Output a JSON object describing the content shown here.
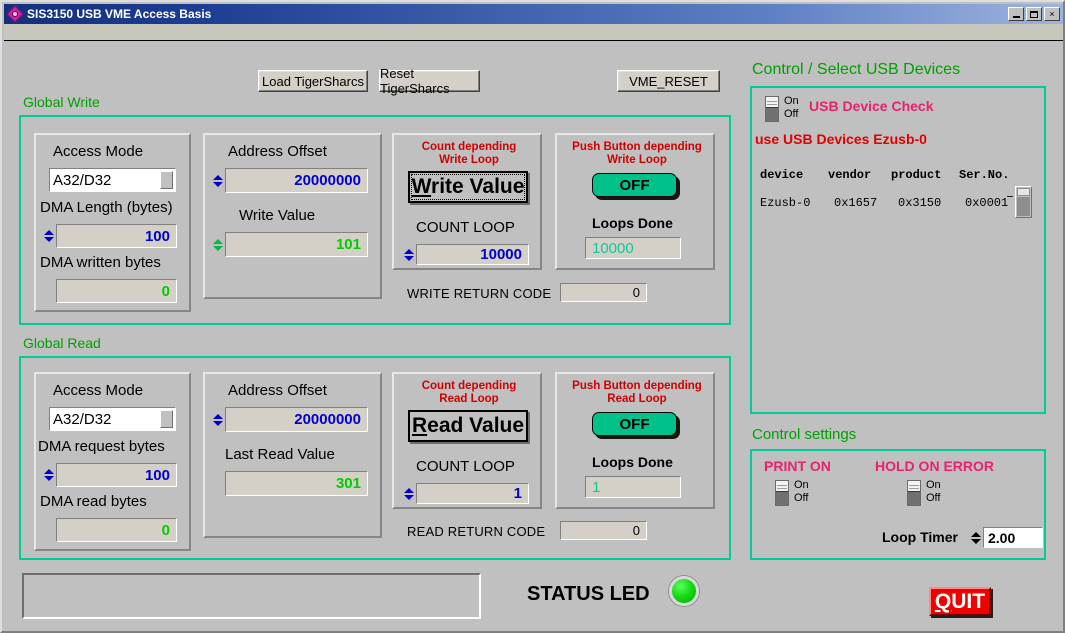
{
  "window": {
    "title": "SIS3150 USB VME Access Basis",
    "icon": "app-diamond-icon",
    "buttons": {
      "minimize": "_",
      "maximize": "□",
      "close": "×"
    }
  },
  "toolbar": {
    "load_tigersharcs": "Load TigerSharcs",
    "reset_tigersharcs": "Reset TigerSharcs",
    "vme_reset": "VME_RESET"
  },
  "global_write": {
    "title": "Global  Write",
    "access": {
      "access_mode_label": "Access Mode",
      "access_mode_value": "A32/D32",
      "dma_length_label": "DMA Length (bytes)",
      "dma_length_value": "100",
      "dma_written_label": "DMA written bytes",
      "dma_written_value": "0"
    },
    "address": {
      "address_offset_label": "Address Offset",
      "address_offset_value": "20000000",
      "write_value_label": "Write Value",
      "write_value_value": "101"
    },
    "count": {
      "caption_line1": "Count depending",
      "caption_line2": "Write Loop",
      "button_accel": "W",
      "button_rest": "rite Value",
      "count_loop_label": "COUNT LOOP",
      "count_loop_value": "10000"
    },
    "push": {
      "caption_line1": "Push Button depending",
      "caption_line2": "Write Loop",
      "toggle_state": "OFF",
      "loops_done_label": "Loops Done",
      "loops_done_value": "10000"
    },
    "return_code_label": "WRITE RETURN CODE",
    "return_code_value": "0"
  },
  "global_read": {
    "title": "Global  Read",
    "access": {
      "access_mode_label": "Access Mode",
      "access_mode_value": "A32/D32",
      "dma_request_label": "DMA request bytes",
      "dma_request_value": "100",
      "dma_read_label": "DMA read bytes",
      "dma_read_value": "0"
    },
    "address": {
      "address_offset_label": "Address Offset",
      "address_offset_value": "20000000",
      "last_read_label": "Last Read Value",
      "last_read_value": "301"
    },
    "count": {
      "caption_line1": "Count depending",
      "caption_line2": "Read Loop",
      "button_accel": "R",
      "button_rest": "ead Value",
      "count_loop_label": "COUNT LOOP",
      "count_loop_value": "1"
    },
    "push": {
      "caption_line1": "Push Button depending",
      "caption_line2": "Read Loop",
      "toggle_state": "OFF",
      "loops_done_label": "Loops Done",
      "loops_done_value": "1"
    },
    "return_code_label": "READ RETURN CODE",
    "return_code_value": "0"
  },
  "usb_panel": {
    "title": "Control / Select USB Devices",
    "check_switch": {
      "on_label": "On",
      "off_label": "Off",
      "state": "Off"
    },
    "check_label": "USB Device Check",
    "in_use_label": "use USB Devices Ezusb-0",
    "table": {
      "headers": [
        "device",
        "vendor",
        "product",
        "Ser.No."
      ],
      "rows": [
        [
          "Ezusb-0",
          "0x1657",
          "0x3150",
          "0x0001"
        ]
      ]
    }
  },
  "control_settings": {
    "title": "Control settings",
    "print_on": {
      "label": "PRINT ON",
      "on_label": "On",
      "off_label": "Off",
      "state": "Off"
    },
    "hold_on_error": {
      "label": "HOLD ON ERROR",
      "on_label": "On",
      "off_label": "Off",
      "state": "Off"
    },
    "loop_timer_label": "Loop Timer",
    "loop_timer_value": "2.00"
  },
  "footer": {
    "log_value": "",
    "status_led_label": "STATUS LED",
    "status_led_state": "on",
    "quit_accel": "Q",
    "quit_rest": "UIT"
  },
  "colors": {
    "frame_green": "#00cc99",
    "group_title_green": "#00a000",
    "caption_red": "#d00000",
    "pink": "#e8226e",
    "value_blue": "#0000d0",
    "value_green": "#00cc00",
    "teal": "#11c79a",
    "quit_red": "#f00000",
    "led_green": "#16dd16"
  }
}
